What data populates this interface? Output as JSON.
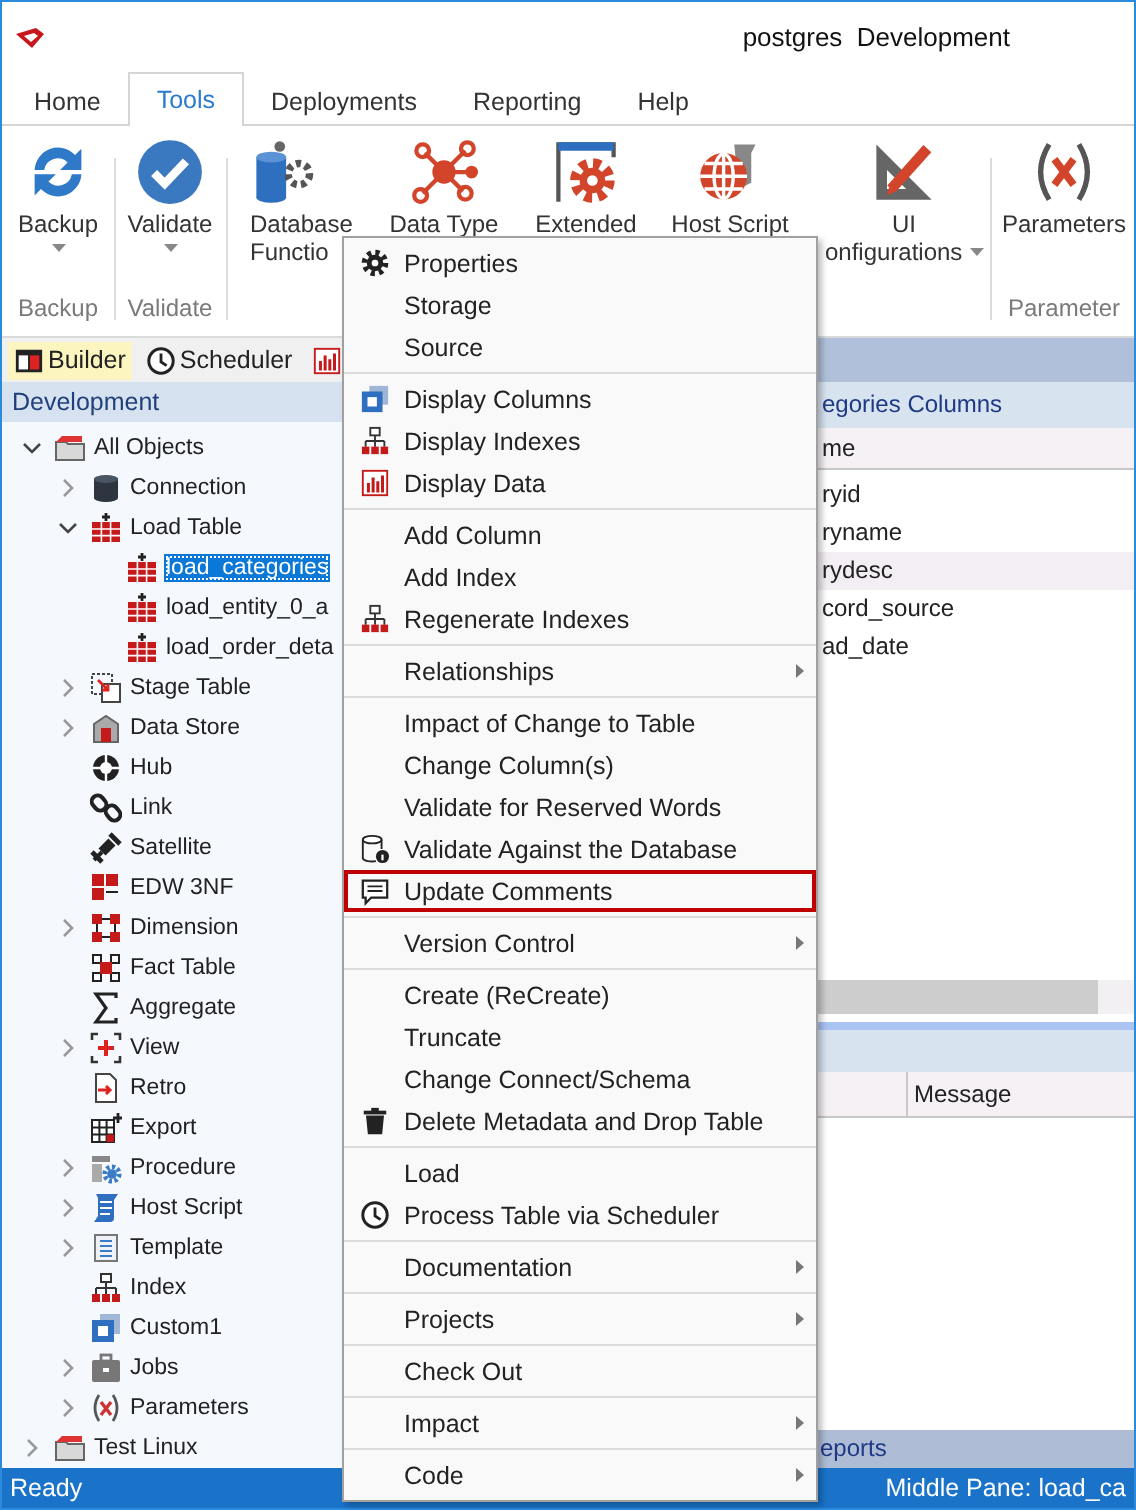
{
  "window": {
    "title": "postgres  Development"
  },
  "tabs": [
    {
      "label": "Home",
      "selected": false
    },
    {
      "label": "Tools",
      "selected": true
    },
    {
      "label": "Deployments",
      "selected": false
    },
    {
      "label": "Reporting",
      "selected": false
    },
    {
      "label": "Help",
      "selected": false
    }
  ],
  "ribbon": {
    "groups": [
      {
        "label": "Backup",
        "buttons": [
          {
            "lines": [
              "Backup"
            ],
            "dropdown": true
          }
        ]
      },
      {
        "label": "Validate",
        "buttons": [
          {
            "lines": [
              "Validate"
            ],
            "dropdown": true
          }
        ]
      },
      {
        "buttons": [
          {
            "lines": [
              "Database",
              "Functio"
            ],
            "dropdown": false
          },
          {
            "lines": [
              "Data Type"
            ],
            "dropdown": false
          },
          {
            "lines": [
              "Extended"
            ],
            "dropdown": false
          },
          {
            "lines": [
              "Host Script"
            ],
            "dropdown": false
          },
          {
            "lines": [
              "UI",
              "onfigurations"
            ],
            "dropdown": true
          }
        ]
      },
      {
        "label": "Parameter",
        "buttons": [
          {
            "lines": [
              "Parameters"
            ],
            "dropdown": false
          }
        ]
      }
    ]
  },
  "explorer": {
    "tabs": [
      {
        "label": "Builder",
        "selected": true
      },
      {
        "label": "Scheduler",
        "selected": false
      },
      {
        "selected": false
      }
    ],
    "header": "Development",
    "tree": [
      {
        "label": "All Objects",
        "kind": "folder",
        "expanded": true,
        "selected": false,
        "children": [
          {
            "label": "Connection",
            "kind": "connection",
            "expanded": false,
            "selected": false
          },
          {
            "label": "Load Table",
            "kind": "table",
            "expanded": true,
            "selected": false,
            "children": [
              {
                "label": "load_categories",
                "kind": "table",
                "selected": true
              },
              {
                "label": "load_entity_0_a",
                "kind": "table",
                "selected": false
              },
              {
                "label": "load_order_deta",
                "kind": "table",
                "selected": false
              }
            ]
          },
          {
            "label": "Stage Table",
            "kind": "stage",
            "expanded": false,
            "selected": false
          },
          {
            "label": "Data Store",
            "kind": "datastore",
            "expanded": false,
            "selected": false
          },
          {
            "label": "Hub",
            "kind": "hub",
            "selected": false
          },
          {
            "label": "Link",
            "kind": "link",
            "selected": false
          },
          {
            "label": "Satellite",
            "kind": "satellite",
            "selected": false
          },
          {
            "label": "EDW 3NF",
            "kind": "edw",
            "selected": false
          },
          {
            "label": "Dimension",
            "kind": "dimension",
            "expanded": false,
            "selected": false
          },
          {
            "label": "Fact Table",
            "kind": "fact",
            "selected": false
          },
          {
            "label": "Aggregate",
            "kind": "aggregate",
            "selected": false
          },
          {
            "label": "View",
            "kind": "view",
            "expanded": false,
            "selected": false
          },
          {
            "label": "Retro",
            "kind": "retro",
            "selected": false
          },
          {
            "label": "Export",
            "kind": "export",
            "selected": false
          },
          {
            "label": "Procedure",
            "kind": "procedure",
            "expanded": false,
            "selected": false
          },
          {
            "label": "Host Script",
            "kind": "hostscript",
            "expanded": false,
            "selected": false
          },
          {
            "label": "Template",
            "kind": "template",
            "expanded": false,
            "selected": false
          },
          {
            "label": "Index",
            "kind": "index",
            "selected": false
          },
          {
            "label": "Custom1",
            "kind": "custom",
            "selected": false
          },
          {
            "label": "Jobs",
            "kind": "jobs",
            "expanded": false,
            "selected": false
          },
          {
            "label": "Parameters",
            "kind": "parameters",
            "expanded": false,
            "selected": false
          }
        ]
      },
      {
        "label": "Test Linux",
        "kind": "folder",
        "expanded": false,
        "selected": false
      }
    ]
  },
  "middle_pane": {
    "title": "egories Columns",
    "column_header": "me",
    "rows": [
      {
        "text": "ryid",
        "highlighted": false
      },
      {
        "text": "ryname",
        "highlighted": false
      },
      {
        "text": "rydesc",
        "highlighted": true
      },
      {
        "text": "cord_source",
        "highlighted": false
      },
      {
        "text": "ad_date",
        "highlighted": false
      }
    ]
  },
  "results_pane": {
    "column_2": "Message",
    "footer": "eports"
  },
  "context_menu": {
    "groups": [
      [
        {
          "label": "Properties",
          "kind": "properties",
          "submenu": false,
          "outlined": false
        },
        {
          "label": "Storage",
          "kind": "plain",
          "submenu": false,
          "outlined": false
        },
        {
          "label": "Source",
          "kind": "plain",
          "submenu": false,
          "outlined": false
        }
      ],
      [
        {
          "label": "Display Columns",
          "kind": "columns",
          "submenu": false,
          "outlined": false
        },
        {
          "label": "Display Indexes",
          "kind": "indexes",
          "submenu": false,
          "outlined": false
        },
        {
          "label": "Display Data",
          "kind": "data",
          "submenu": false,
          "outlined": false
        }
      ],
      [
        {
          "label": "Add Column",
          "kind": "plain",
          "submenu": false,
          "outlined": false
        },
        {
          "label": "Add Index",
          "kind": "plain",
          "submenu": false,
          "outlined": false
        },
        {
          "label": "Regenerate Indexes",
          "kind": "indexes",
          "submenu": false,
          "outlined": false
        }
      ],
      [
        {
          "label": "Relationships",
          "kind": "plain",
          "submenu": true,
          "outlined": false
        }
      ],
      [
        {
          "label": "Impact of Change to Table",
          "kind": "plain",
          "submenu": false,
          "outlined": false
        },
        {
          "label": "Change Column(s)",
          "kind": "plain",
          "submenu": false,
          "outlined": false
        },
        {
          "label": "Validate for Reserved Words",
          "kind": "plain",
          "submenu": false,
          "outlined": false
        },
        {
          "label": "Validate Against the Database",
          "kind": "validate",
          "submenu": false,
          "outlined": false
        },
        {
          "label": "Update Comments",
          "kind": "comments",
          "submenu": false,
          "outlined": true
        }
      ],
      [
        {
          "label": "Version Control",
          "kind": "plain",
          "submenu": true,
          "outlined": false
        }
      ],
      [
        {
          "label": "Create (ReCreate)",
          "kind": "plain",
          "submenu": false,
          "outlined": false
        },
        {
          "label": "Truncate",
          "kind": "plain",
          "submenu": false,
          "outlined": false
        },
        {
          "label": "Change Connect/Schema",
          "kind": "plain",
          "submenu": false,
          "outlined": false
        },
        {
          "label": "Delete Metadata and Drop Table",
          "kind": "delete",
          "submenu": false,
          "outlined": false
        }
      ],
      [
        {
          "label": "Load",
          "kind": "plain",
          "submenu": false,
          "outlined": false
        },
        {
          "label": "Process Table via Scheduler",
          "kind": "schedule",
          "submenu": false,
          "outlined": false
        }
      ],
      [
        {
          "label": "Documentation",
          "kind": "plain",
          "submenu": true,
          "outlined": false
        }
      ],
      [
        {
          "label": "Projects",
          "kind": "plain",
          "submenu": true,
          "outlined": false
        }
      ],
      [
        {
          "label": "Check Out",
          "kind": "plain",
          "submenu": false,
          "outlined": false
        }
      ],
      [
        {
          "label": "Impact",
          "kind": "plain",
          "submenu": true,
          "outlined": false
        }
      ],
      [
        {
          "label": "Code",
          "kind": "plain",
          "submenu": true,
          "outlined": false
        }
      ]
    ]
  },
  "status_bar": {
    "left": "Ready",
    "right": "Middle Pane: load_ca"
  }
}
